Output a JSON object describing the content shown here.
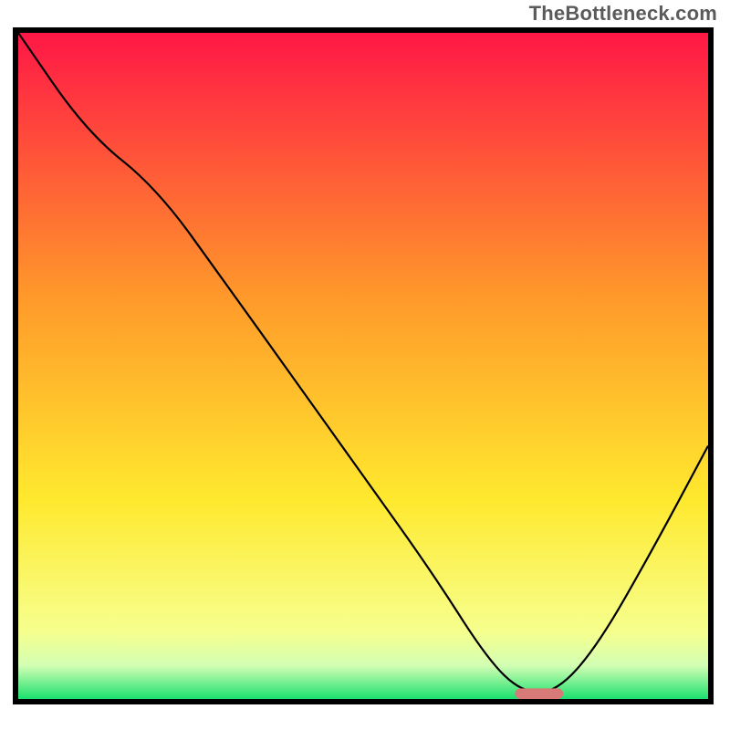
{
  "watermark": "TheBottleneck.com",
  "chart_data": {
    "type": "line",
    "title": "",
    "xlabel": "",
    "ylabel": "",
    "xlim": [
      0,
      100
    ],
    "ylim": [
      0,
      100
    ],
    "grid": false,
    "legend": false,
    "background_gradient_stops": [
      {
        "offset": 0.0,
        "color": "#ff1746"
      },
      {
        "offset": 0.4,
        "color": "#ff9a2a"
      },
      {
        "offset": 0.7,
        "color": "#ffe92e"
      },
      {
        "offset": 0.9,
        "color": "#f6ff8e"
      },
      {
        "offset": 0.95,
        "color": "#d2ffb4"
      },
      {
        "offset": 1.0,
        "color": "#1be06e"
      }
    ],
    "series": [
      {
        "name": "bottleneck-curve",
        "color": "#000000",
        "points": [
          {
            "x": 0.0,
            "y": 100.0
          },
          {
            "x": 10.0,
            "y": 85.0
          },
          {
            "x": 20.0,
            "y": 76.8
          },
          {
            "x": 30.0,
            "y": 62.5
          },
          {
            "x": 40.0,
            "y": 48.0
          },
          {
            "x": 50.0,
            "y": 33.5
          },
          {
            "x": 60.0,
            "y": 19.0
          },
          {
            "x": 68.0,
            "y": 6.0
          },
          {
            "x": 73.0,
            "y": 1.0
          },
          {
            "x": 78.0,
            "y": 1.0
          },
          {
            "x": 84.0,
            "y": 8.0
          },
          {
            "x": 92.0,
            "y": 22.5
          },
          {
            "x": 100.0,
            "y": 38.0
          }
        ]
      }
    ],
    "marker": {
      "name": "optimal-range-marker",
      "color": "#d87a78",
      "x_start": 72.0,
      "x_end": 79.0,
      "y": 0.8,
      "height": 1.6,
      "corner_radius": 0.8
    }
  }
}
